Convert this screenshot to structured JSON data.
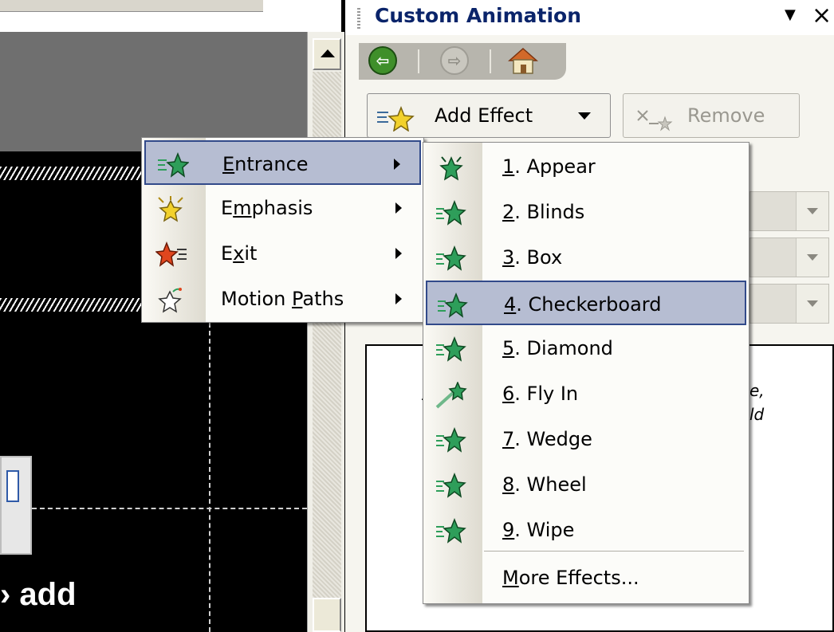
{
  "slide": {
    "partial_text": "› add"
  },
  "task_pane": {
    "title": "Custom Animation",
    "buttons": {
      "add_effect": "Add Effect",
      "remove": "Remove"
    },
    "list_text_1": "e,",
    "list_text_2": "ld",
    "list_text_3": "-"
  },
  "effect_menu": {
    "items": [
      {
        "pre": "",
        "key": "E",
        "post": "ntrance",
        "icon": "entrance-star-icon",
        "highlighted": true
      },
      {
        "pre": "E",
        "key": "m",
        "post": "phasis",
        "icon": "emphasis-star-icon"
      },
      {
        "pre": "E",
        "key": "x",
        "post": "it",
        "icon": "exit-star-icon"
      },
      {
        "pre": "Motion ",
        "key": "P",
        "post": "aths",
        "icon": "motion-paths-star-icon"
      }
    ]
  },
  "entrance_menu": {
    "items": [
      {
        "key": "1",
        "rest": ". Appear"
      },
      {
        "key": "2",
        "rest": ". Blinds"
      },
      {
        "key": "3",
        "rest": ". Box"
      },
      {
        "key": "4",
        "rest": ". Checkerboard",
        "highlighted": true
      },
      {
        "key": "5",
        "rest": ". Diamond"
      },
      {
        "key": "6",
        "rest": ". Fly In"
      },
      {
        "key": "7",
        "rest": ". Wedge"
      },
      {
        "key": "8",
        "rest": ". Wheel"
      },
      {
        "key": "9",
        "rest": ". Wipe"
      }
    ],
    "more": {
      "key": "M",
      "rest": "ore Effects..."
    }
  },
  "colors": {
    "highlight": "#b6bdd2",
    "highlight_border": "#324a8a",
    "title": "#0a246a",
    "entrance_star": "#2e9e5a",
    "emphasis_star": "#f2d12c",
    "exit_star": "#e0461e"
  }
}
